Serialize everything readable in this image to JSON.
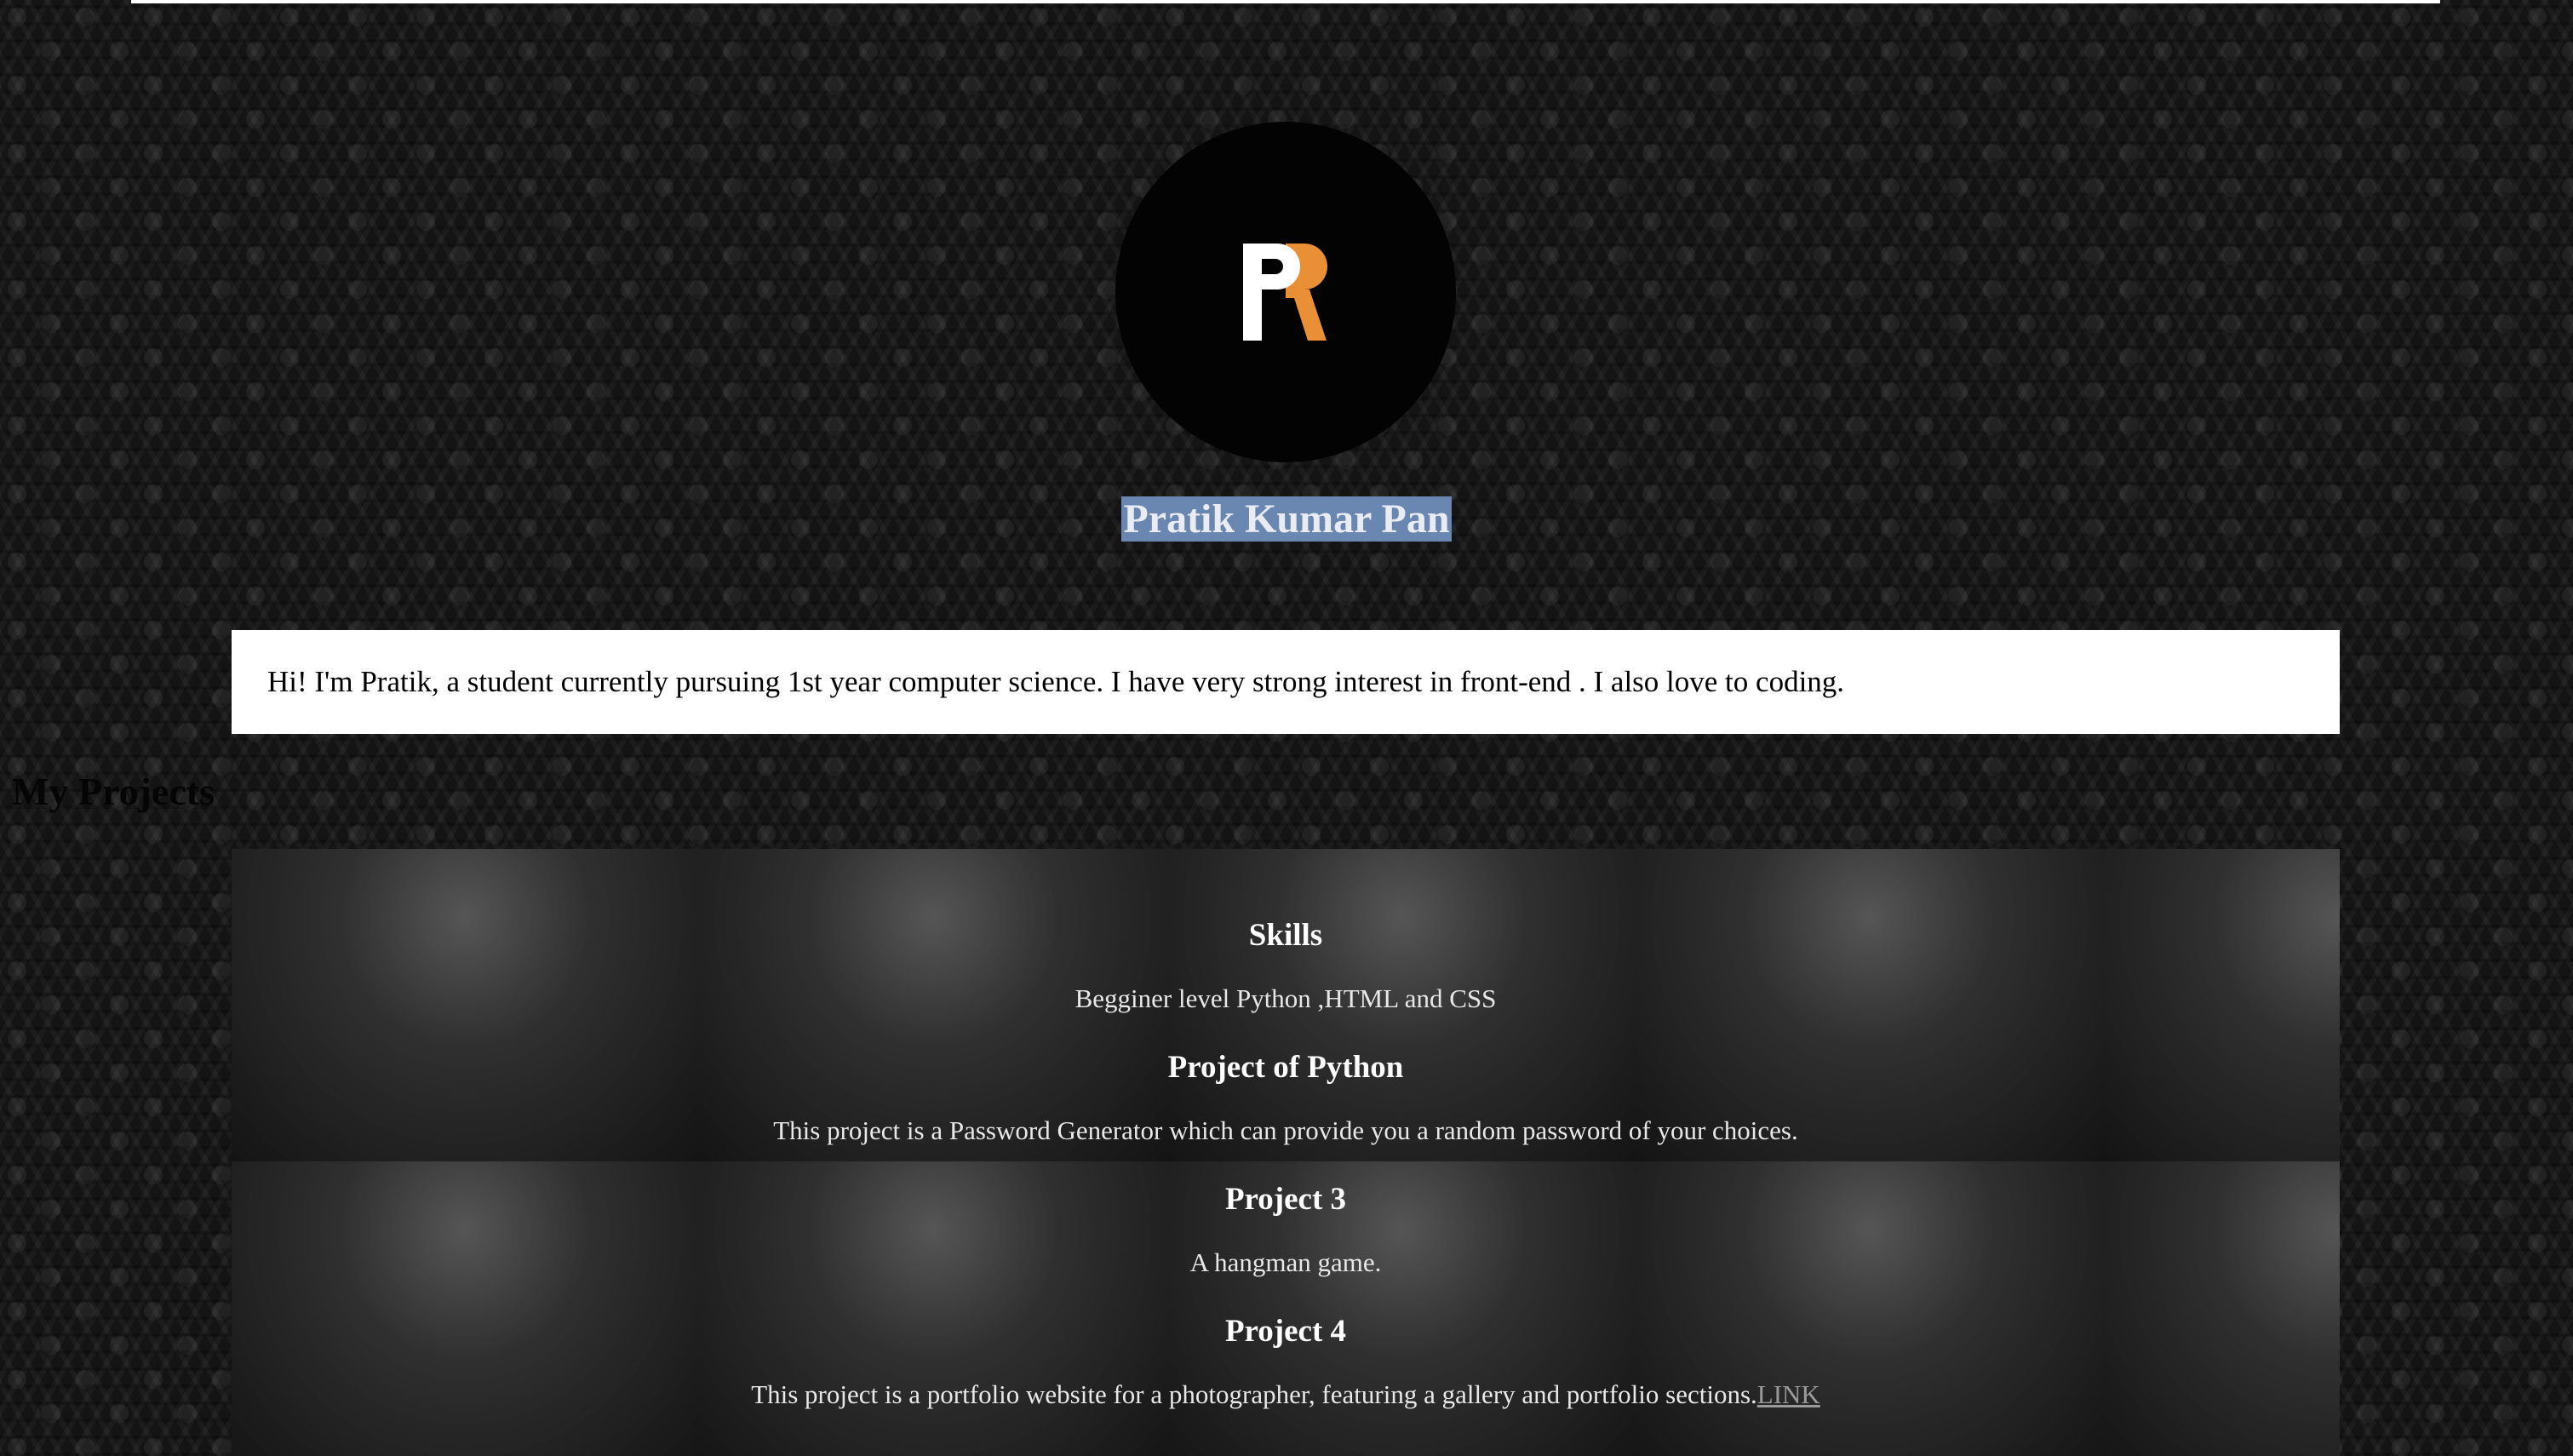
{
  "profile": {
    "logo_icon": "pr-monogram-logo",
    "logo_colors": {
      "p": "#ffffff",
      "r": "#e98f35"
    },
    "name": "Pratik Kumar Pan",
    "name_highlight": "#6a87b2"
  },
  "intro": {
    "text": "Hi! I'm Pratik, a student currently pursuing 1st year computer science. I have very strong interest in front-end . I also love to coding."
  },
  "projects": {
    "heading": "My Projects",
    "sections": [
      {
        "title": "Skills",
        "description": "Begginer level Python ,HTML and CSS"
      },
      {
        "title": "Project of Python",
        "description": "This project is a Password Generator which can provide you a random password of your choices."
      },
      {
        "title": "Project 3",
        "description": "A hangman game."
      },
      {
        "title": "Project 4",
        "description": "This project is a portfolio website for a photographer, featuring a gallery and portfolio sections.",
        "link_label": "LINK"
      }
    ]
  }
}
